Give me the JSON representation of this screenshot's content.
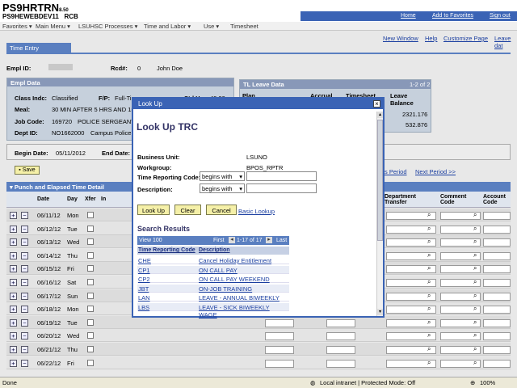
{
  "header": {
    "system": "PS9HRTRN",
    "version": "8.50",
    "db": "PS9HEWEBDEV11",
    "rcb": "RCB",
    "links": [
      "Home",
      "Add to Favorites",
      "Sign out"
    ]
  },
  "nav": [
    "Favorites ▾",
    "Main Menu ▾",
    "LSUHSC Processes ▾",
    "Time and Labor ▾",
    "Use ▾",
    "Timesheet"
  ],
  "page": {
    "tab": "Time Entry",
    "right_links": [
      "New Window",
      "Help",
      "Customize Page",
      "Leave dat"
    ],
    "empl_id_label": "Empl ID:",
    "empl_id_value": "",
    "rcd_label": "Rcd#:",
    "rcd_value": "0",
    "name": "John Doe",
    "empl_data_title": "Empl Data",
    "class_label": "Class Indc:",
    "class_value": "Classified",
    "fp_label": "F/P:",
    "fp_value": "Full-Time",
    "std_label": "Std Hrs:",
    "std_value": "40.00",
    "meal_label": "Meal:",
    "meal_value": "30 MIN AFTER 5 HRS AND 15",
    "job_label": "Job Code:",
    "job_value": "169720",
    "job_desc": "POLICE SERGEANT",
    "dept_label": "Dept ID:",
    "dept_value": "NO1662000",
    "dept_desc": "Campus Police",
    "begin_label": "Begin Date:",
    "begin_value": "05/11/2012",
    "end_label": "End Date:",
    "save_label": "Save",
    "prev_period": "s Period",
    "next_period": "Next Period >>",
    "tl_leave_title": "TL Leave Data",
    "tl_pager": "1-2 of 2",
    "tl_headers": [
      "Plan",
      "Accrual",
      "Timesheet",
      "Leave Balance"
    ],
    "tl_values": [
      "2321.176",
      "532.876"
    ],
    "grid_title": "Punch and Elapsed Time Detail",
    "grid_headers": [
      "Date",
      "Day",
      "Xfer",
      "In",
      "Department Transfer",
      "Comment Code",
      "Account Code"
    ],
    "rows": [
      {
        "date": "06/11/12",
        "day": "Mon"
      },
      {
        "date": "06/12/12",
        "day": "Tue"
      },
      {
        "date": "06/13/12",
        "day": "Wed"
      },
      {
        "date": "06/14/12",
        "day": "Thu"
      },
      {
        "date": "06/15/12",
        "day": "Fri"
      },
      {
        "date": "06/16/12",
        "day": "Sat"
      },
      {
        "date": "06/17/12",
        "day": "Sun"
      },
      {
        "date": "06/18/12",
        "day": "Mon"
      },
      {
        "date": "06/19/12",
        "day": "Tue"
      },
      {
        "date": "06/20/12",
        "day": "Wed"
      },
      {
        "date": "06/21/12",
        "day": "Thu"
      },
      {
        "date": "06/22/12",
        "day": "Fri"
      }
    ]
  },
  "modal": {
    "title": "Look Up",
    "heading": "Look Up TRC",
    "bu_label": "Business Unit:",
    "bu_value": "LSUNO",
    "wg_label": "Workgroup:",
    "wg_value": "BPOS_RPTR",
    "trc_label": "Time Reporting Code:",
    "trc_op": "begins with",
    "desc_label": "Description:",
    "desc_op": "begins with",
    "btn_lookup": "Look Up",
    "btn_clear": "Clear",
    "btn_cancel": "Cancel",
    "basic_lookup": "Basic Lookup",
    "results_title": "Search Results",
    "view": "View 100",
    "first": "First",
    "range": "1-17 of 17",
    "last": "Last",
    "col_code": "Time Reporting Code",
    "col_desc": "Description",
    "results": [
      {
        "code": "CHE",
        "desc": "Cancel Holiday Entitlement"
      },
      {
        "code": "CP1",
        "desc": "ON CALL PAY"
      },
      {
        "code": "CP2",
        "desc": "ON CALL PAY WEEKEND"
      },
      {
        "code": "JBT",
        "desc": "ON-JOB TRAINING"
      },
      {
        "code": "LAN",
        "desc": "LEAVE - ANNUAL BIWEEKLY"
      },
      {
        "code": "LBS",
        "desc": "LEAVE - SICK BIWEEKLY WAGE"
      }
    ]
  },
  "status": {
    "left": "Done",
    "zone": "Local intranet | Protected Mode: Off",
    "zoom": "100%"
  }
}
